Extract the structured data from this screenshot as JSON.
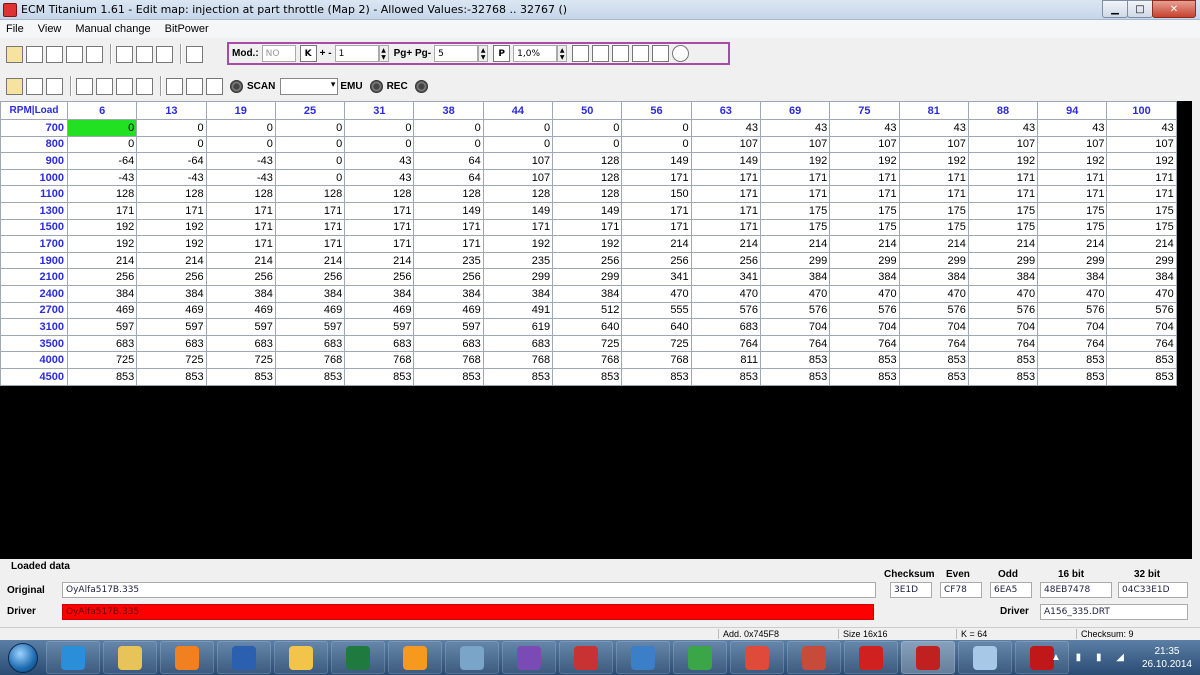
{
  "window": {
    "title": "ECM Titanium 1.61 - Edit map: injection at part throttle (Map 2) - Allowed Values:-32768 .. 32767 ()",
    "min_glyph": "▁",
    "max_glyph": "□",
    "close_glyph": "✕"
  },
  "menu": [
    "File",
    "View",
    "Manual change",
    "BitPower"
  ],
  "modbar": {
    "mod_label": "Mod.:",
    "mod_value": "NO",
    "k_label": "K",
    "plusminus_label": "+ -",
    "plusminus_value": "1",
    "pg_label": "Pg+ Pg-",
    "pg_value": "5",
    "p_label": "P",
    "percent_value": "1,0%"
  },
  "toolbar2": {
    "scan_label": "SCAN",
    "emu_label": "EMU",
    "rec_label": "REC"
  },
  "grid": {
    "corner": "RPM|Load",
    "columns": [
      "6",
      "13",
      "19",
      "25",
      "31",
      "38",
      "44",
      "50",
      "56",
      "63",
      "69",
      "75",
      "81",
      "88",
      "94",
      "100"
    ],
    "rows": [
      {
        "rpm": "700",
        "values": [
          "0",
          "0",
          "0",
          "0",
          "0",
          "0",
          "0",
          "0",
          "0",
          "43",
          "43",
          "43",
          "43",
          "43",
          "43",
          "43"
        ]
      },
      {
        "rpm": "800",
        "values": [
          "0",
          "0",
          "0",
          "0",
          "0",
          "0",
          "0",
          "0",
          "0",
          "107",
          "107",
          "107",
          "107",
          "107",
          "107",
          "107"
        ]
      },
      {
        "rpm": "900",
        "values": [
          "-64",
          "-64",
          "-43",
          "0",
          "43",
          "64",
          "107",
          "128",
          "149",
          "149",
          "192",
          "192",
          "192",
          "192",
          "192",
          "192"
        ]
      },
      {
        "rpm": "1000",
        "values": [
          "-43",
          "-43",
          "-43",
          "0",
          "43",
          "64",
          "107",
          "128",
          "171",
          "171",
          "171",
          "171",
          "171",
          "171",
          "171",
          "171"
        ]
      },
      {
        "rpm": "1100",
        "values": [
          "128",
          "128",
          "128",
          "128",
          "128",
          "128",
          "128",
          "128",
          "150",
          "171",
          "171",
          "171",
          "171",
          "171",
          "171",
          "171"
        ]
      },
      {
        "rpm": "1300",
        "values": [
          "171",
          "171",
          "171",
          "171",
          "171",
          "149",
          "149",
          "149",
          "171",
          "171",
          "175",
          "175",
          "175",
          "175",
          "175",
          "175"
        ]
      },
      {
        "rpm": "1500",
        "values": [
          "192",
          "192",
          "171",
          "171",
          "171",
          "171",
          "171",
          "171",
          "171",
          "171",
          "175",
          "175",
          "175",
          "175",
          "175",
          "175"
        ]
      },
      {
        "rpm": "1700",
        "values": [
          "192",
          "192",
          "171",
          "171",
          "171",
          "171",
          "192",
          "192",
          "214",
          "214",
          "214",
          "214",
          "214",
          "214",
          "214",
          "214"
        ]
      },
      {
        "rpm": "1900",
        "values": [
          "214",
          "214",
          "214",
          "214",
          "214",
          "235",
          "235",
          "256",
          "256",
          "256",
          "299",
          "299",
          "299",
          "299",
          "299",
          "299"
        ]
      },
      {
        "rpm": "2100",
        "values": [
          "256",
          "256",
          "256",
          "256",
          "256",
          "256",
          "299",
          "299",
          "341",
          "341",
          "384",
          "384",
          "384",
          "384",
          "384",
          "384"
        ]
      },
      {
        "rpm": "2400",
        "values": [
          "384",
          "384",
          "384",
          "384",
          "384",
          "384",
          "384",
          "384",
          "470",
          "470",
          "470",
          "470",
          "470",
          "470",
          "470",
          "470"
        ]
      },
      {
        "rpm": "2700",
        "values": [
          "469",
          "469",
          "469",
          "469",
          "469",
          "469",
          "491",
          "512",
          "555",
          "576",
          "576",
          "576",
          "576",
          "576",
          "576",
          "576"
        ]
      },
      {
        "rpm": "3100",
        "values": [
          "597",
          "597",
          "597",
          "597",
          "597",
          "597",
          "619",
          "640",
          "640",
          "683",
          "704",
          "704",
          "704",
          "704",
          "704",
          "704"
        ]
      },
      {
        "rpm": "3500",
        "values": [
          "683",
          "683",
          "683",
          "683",
          "683",
          "683",
          "683",
          "725",
          "725",
          "764",
          "764",
          "764",
          "764",
          "764",
          "764",
          "764"
        ]
      },
      {
        "rpm": "4000",
        "values": [
          "725",
          "725",
          "725",
          "768",
          "768",
          "768",
          "768",
          "768",
          "768",
          "811",
          "853",
          "853",
          "853",
          "853",
          "853",
          "853"
        ]
      },
      {
        "rpm": "4500",
        "values": [
          "853",
          "853",
          "853",
          "853",
          "853",
          "853",
          "853",
          "853",
          "853",
          "853",
          "853",
          "853",
          "853",
          "853",
          "853",
          "853"
        ]
      }
    ]
  },
  "loaded": {
    "section_label": "Loaded data",
    "original_label": "Original",
    "original_value": "OyAlfa517B.335",
    "driver_label": "Driver",
    "driver_value": "OyAlfa517B.335",
    "checksum_label": "Checksum",
    "checksum_value": "3E1D",
    "even_label": "Even",
    "even_value": "CF78",
    "odd_label": "Odd",
    "odd_value": "6EA5",
    "bit16_label": "16 bit",
    "bit16_value": "48EB7478",
    "bit32_label": "32 bit",
    "bit32_value": "04C33E1D",
    "driver2_label": "Driver",
    "driver2_value": "A156_335.DRT"
  },
  "status": {
    "addr": "Add. 0x745F8",
    "size": "Size 16x16",
    "k": "K = 64",
    "checksum": "Checksum: 9"
  },
  "taskbar": {
    "apps": [
      {
        "name": "internet-explorer",
        "color": "#2a8fd8"
      },
      {
        "name": "file-explorer",
        "color": "#e8c35a"
      },
      {
        "name": "media-player",
        "color": "#f08020"
      },
      {
        "name": "word",
        "color": "#2b5fb0"
      },
      {
        "name": "mail",
        "color": "#f2c54a"
      },
      {
        "name": "excel",
        "color": "#1e7a3e"
      },
      {
        "name": "orange-app",
        "color": "#f59a1f"
      },
      {
        "name": "c-app",
        "color": "#7aa4c8"
      },
      {
        "name": "viber",
        "color": "#7a4bb5"
      },
      {
        "name": "download-app",
        "color": "#c83232"
      },
      {
        "name": "google-earth",
        "color": "#3a7fc8"
      },
      {
        "name": "sync-app",
        "color": "#3aa648"
      },
      {
        "name": "chrome",
        "color": "#e04a3a"
      },
      {
        "name": "globe-app",
        "color": "#c84a3a"
      },
      {
        "name": "nero",
        "color": "#d02020"
      },
      {
        "name": "ecm-titanium",
        "color": "#c02020"
      },
      {
        "name": "notes-app",
        "color": "#a8c8e8"
      },
      {
        "name": "ecm-red-app",
        "color": "#c01818"
      }
    ],
    "time": "21:35",
    "date": "26.10.2014"
  }
}
